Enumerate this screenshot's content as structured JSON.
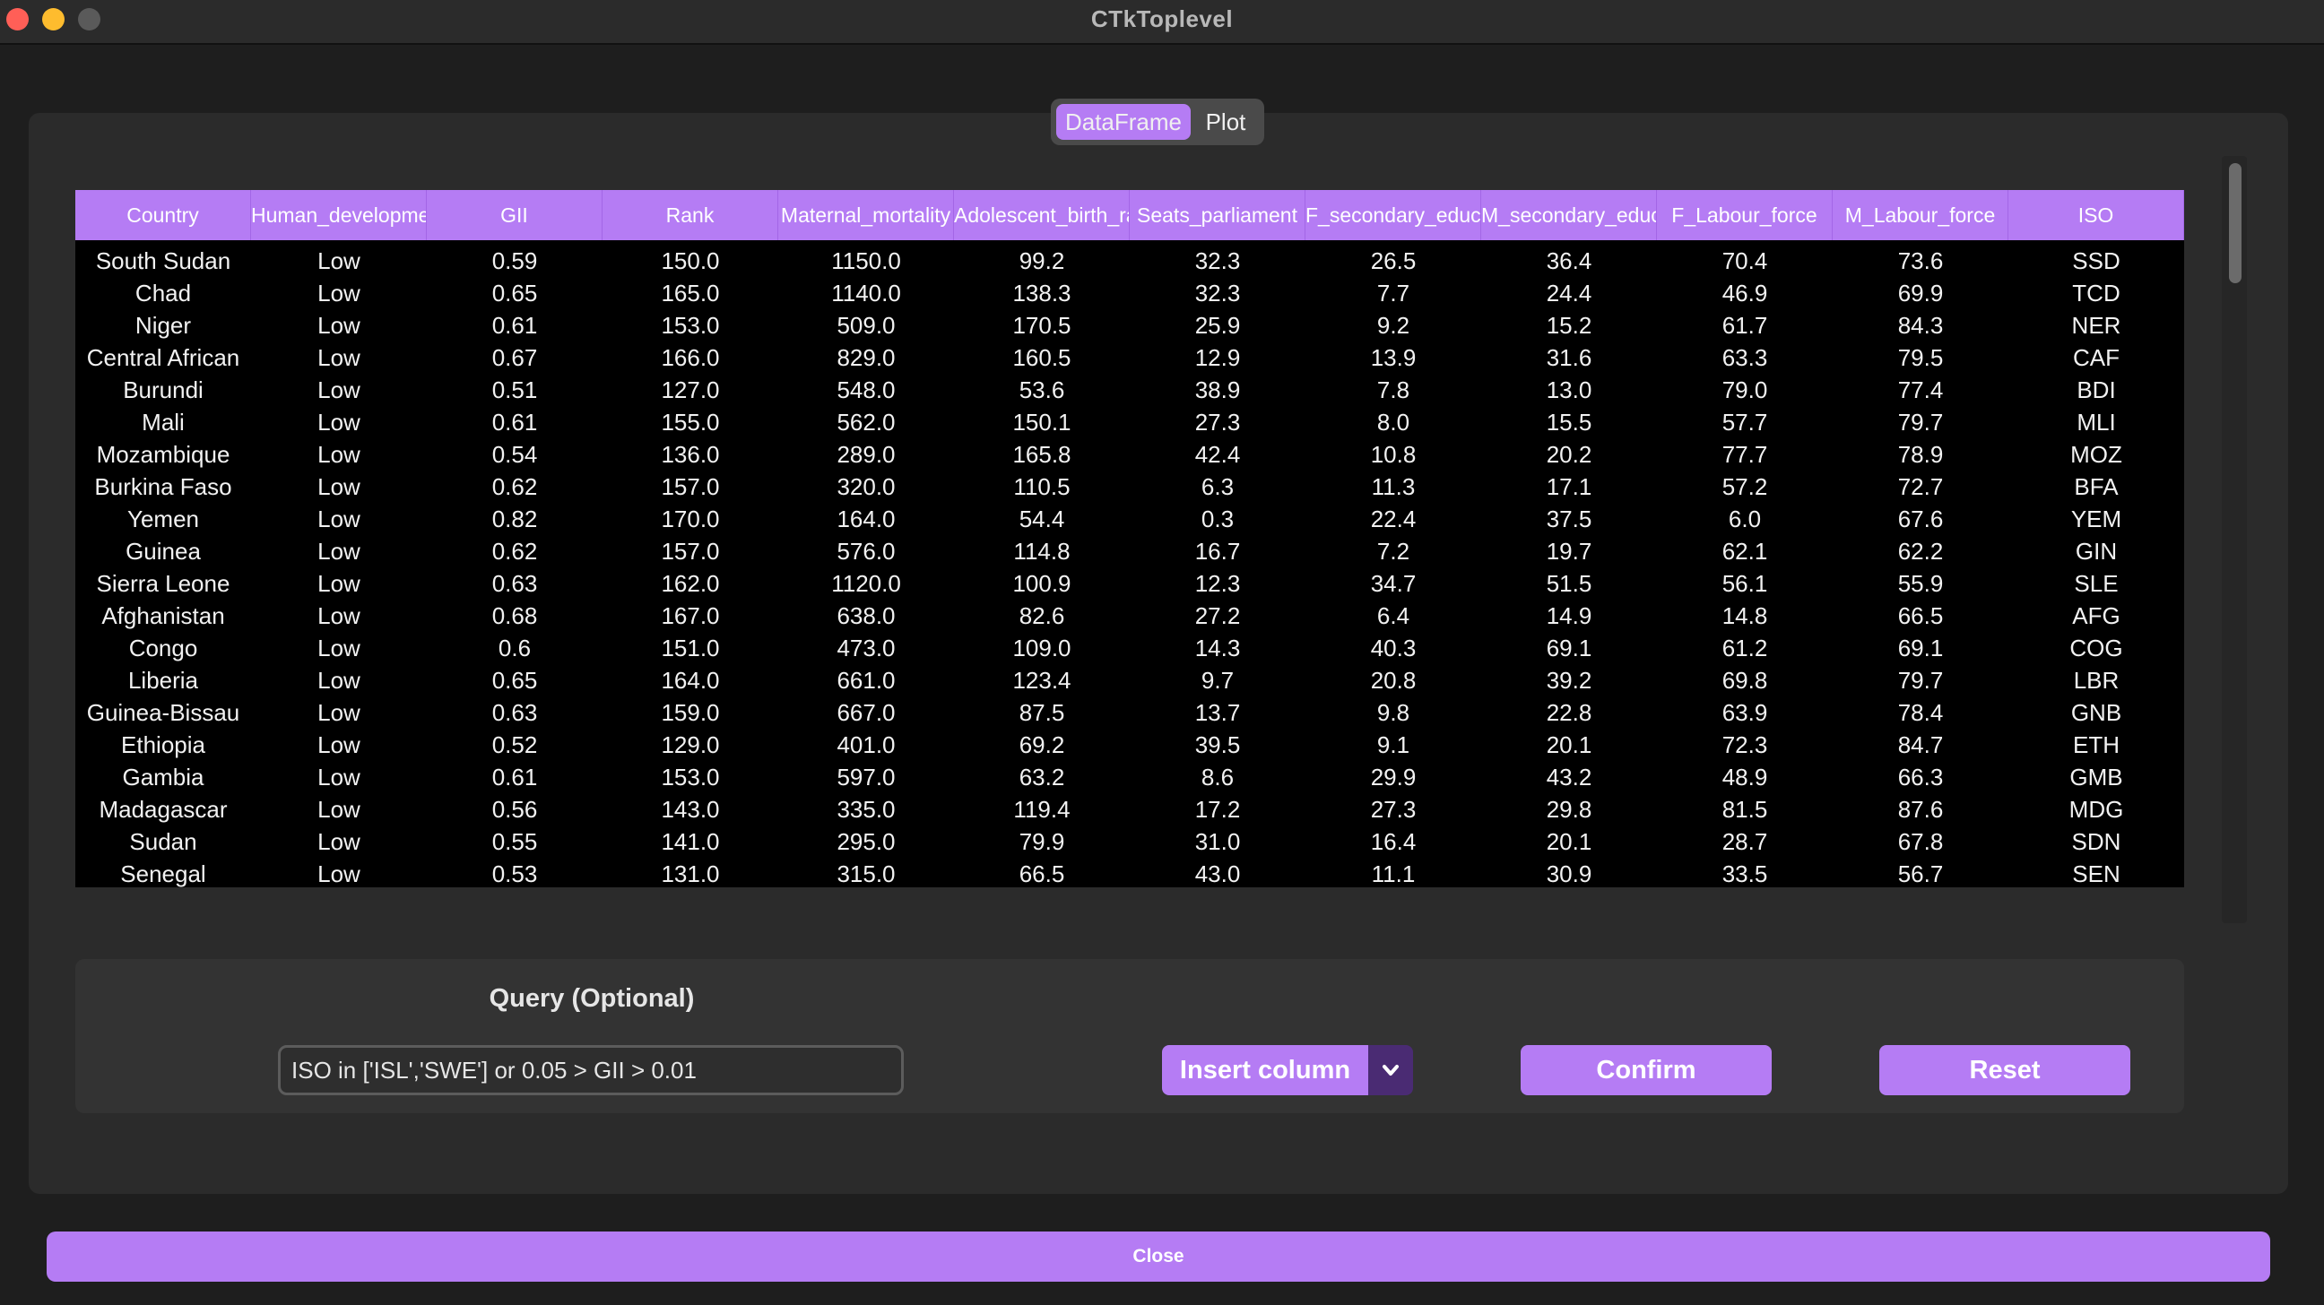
{
  "window": {
    "title": "CTkToplevel"
  },
  "tabs": {
    "active": "DataFrame",
    "other": "Plot"
  },
  "table": {
    "columns": [
      "Country",
      "Human_development",
      "GII",
      "Rank",
      "Maternal_mortality",
      "Adolescent_birth_rate",
      "Seats_parliament",
      "F_secondary_educ",
      "M_secondary_educ",
      "F_Labour_force",
      "M_Labour_force",
      "ISO"
    ],
    "rows": [
      [
        "South Sudan",
        "Low",
        "0.59",
        "150.0",
        "1150.0",
        "99.2",
        "32.3",
        "26.5",
        "36.4",
        "70.4",
        "73.6",
        "SSD"
      ],
      [
        "Chad",
        "Low",
        "0.65",
        "165.0",
        "1140.0",
        "138.3",
        "32.3",
        "7.7",
        "24.4",
        "46.9",
        "69.9",
        "TCD"
      ],
      [
        "Niger",
        "Low",
        "0.61",
        "153.0",
        "509.0",
        "170.5",
        "25.9",
        "9.2",
        "15.2",
        "61.7",
        "84.3",
        "NER"
      ],
      [
        "Central African",
        "Low",
        "0.67",
        "166.0",
        "829.0",
        "160.5",
        "12.9",
        "13.9",
        "31.6",
        "63.3",
        "79.5",
        "CAF"
      ],
      [
        "Burundi",
        "Low",
        "0.51",
        "127.0",
        "548.0",
        "53.6",
        "38.9",
        "7.8",
        "13.0",
        "79.0",
        "77.4",
        "BDI"
      ],
      [
        "Mali",
        "Low",
        "0.61",
        "155.0",
        "562.0",
        "150.1",
        "27.3",
        "8.0",
        "15.5",
        "57.7",
        "79.7",
        "MLI"
      ],
      [
        "Mozambique",
        "Low",
        "0.54",
        "136.0",
        "289.0",
        "165.8",
        "42.4",
        "10.8",
        "20.2",
        "77.7",
        "78.9",
        "MOZ"
      ],
      [
        "Burkina Faso",
        "Low",
        "0.62",
        "157.0",
        "320.0",
        "110.5",
        "6.3",
        "11.3",
        "17.1",
        "57.2",
        "72.7",
        "BFA"
      ],
      [
        "Yemen",
        "Low",
        "0.82",
        "170.0",
        "164.0",
        "54.4",
        "0.3",
        "22.4",
        "37.5",
        "6.0",
        "67.6",
        "YEM"
      ],
      [
        "Guinea",
        "Low",
        "0.62",
        "157.0",
        "576.0",
        "114.8",
        "16.7",
        "7.2",
        "19.7",
        "62.1",
        "62.2",
        "GIN"
      ],
      [
        "Sierra Leone",
        "Low",
        "0.63",
        "162.0",
        "1120.0",
        "100.9",
        "12.3",
        "34.7",
        "51.5",
        "56.1",
        "55.9",
        "SLE"
      ],
      [
        "Afghanistan",
        "Low",
        "0.68",
        "167.0",
        "638.0",
        "82.6",
        "27.2",
        "6.4",
        "14.9",
        "14.8",
        "66.5",
        "AFG"
      ],
      [
        "Congo",
        "Low",
        "0.6",
        "151.0",
        "473.0",
        "109.0",
        "14.3",
        "40.3",
        "69.1",
        "61.2",
        "69.1",
        "COG"
      ],
      [
        "Liberia",
        "Low",
        "0.65",
        "164.0",
        "661.0",
        "123.4",
        "9.7",
        "20.8",
        "39.2",
        "69.8",
        "79.7",
        "LBR"
      ],
      [
        "Guinea-Bissau",
        "Low",
        "0.63",
        "159.0",
        "667.0",
        "87.5",
        "13.7",
        "9.8",
        "22.8",
        "63.9",
        "78.4",
        "GNB"
      ],
      [
        "Ethiopia",
        "Low",
        "0.52",
        "129.0",
        "401.0",
        "69.2",
        "39.5",
        "9.1",
        "20.1",
        "72.3",
        "84.7",
        "ETH"
      ],
      [
        "Gambia",
        "Low",
        "0.61",
        "153.0",
        "597.0",
        "63.2",
        "8.6",
        "29.9",
        "43.2",
        "48.9",
        "66.3",
        "GMB"
      ],
      [
        "Madagascar",
        "Low",
        "0.56",
        "143.0",
        "335.0",
        "119.4",
        "17.2",
        "27.3",
        "29.8",
        "81.5",
        "87.6",
        "MDG"
      ],
      [
        "Sudan",
        "Low",
        "0.55",
        "141.0",
        "295.0",
        "79.9",
        "31.0",
        "16.4",
        "20.1",
        "28.7",
        "67.8",
        "SDN"
      ],
      [
        "Senegal",
        "Low",
        "0.53",
        "131.0",
        "315.0",
        "66.5",
        "43.0",
        "11.1",
        "30.9",
        "33.5",
        "56.7",
        "SEN"
      ]
    ]
  },
  "query": {
    "label": "Query (Optional)",
    "value": "ISO in ['ISL','SWE'] or 0.05 > GII > 0.01"
  },
  "buttons": {
    "insert_column": "Insert column",
    "confirm": "Confirm",
    "reset": "Reset",
    "close": "Close"
  },
  "colors": {
    "accent": "#b57cf4",
    "background": "#1e1e1e",
    "panel": "#2b2b2b"
  },
  "icons": {
    "dropdown": "chevron-down-icon"
  }
}
